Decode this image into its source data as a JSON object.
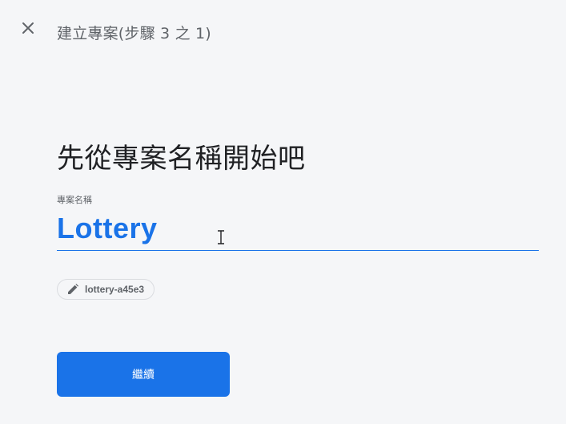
{
  "header": {
    "title": "建立專案(步驟 3 之 1)",
    "close_icon": "close-icon"
  },
  "main": {
    "heading": "先從專案名稱開始吧",
    "field_label": "專案名稱",
    "project_name_value": "Lottery",
    "project_id": "lottery-a45e3",
    "project_id_icon": "pencil-icon",
    "continue_label": "繼續"
  },
  "colors": {
    "accent": "#1a73e8",
    "background": "#f5f6f8",
    "text_primary": "#202124",
    "text_secondary": "#5f6368",
    "chip_border": "#dadce0"
  }
}
